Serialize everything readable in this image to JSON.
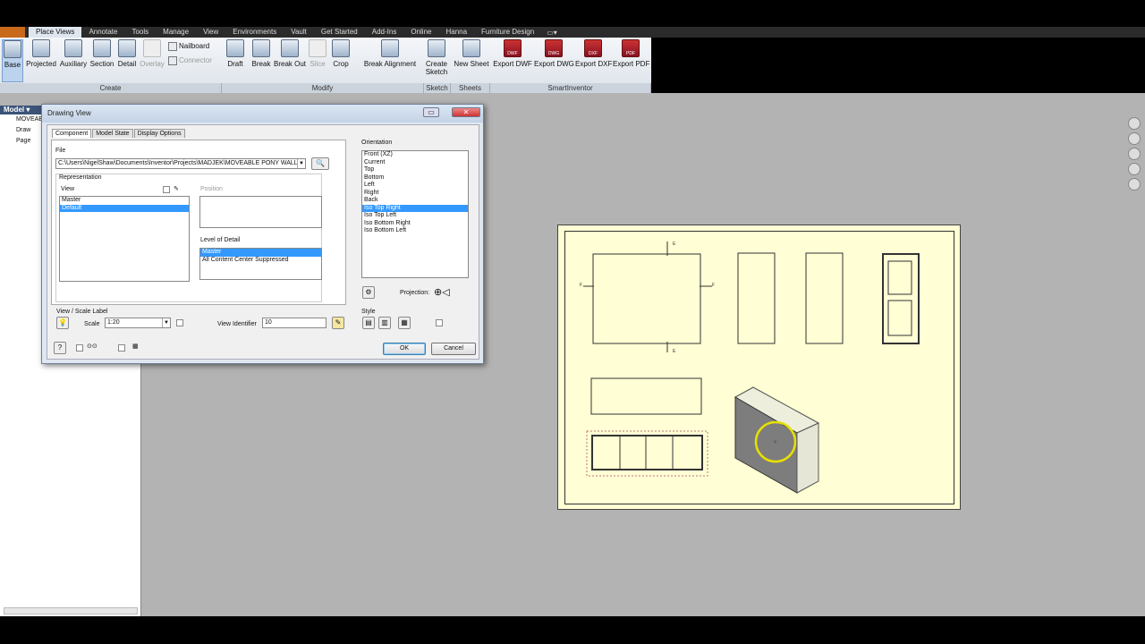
{
  "ribbon": {
    "tabs": [
      "Place Views",
      "Annotate",
      "Tools",
      "Manage",
      "View",
      "Environments",
      "Vault",
      "Get Started",
      "Add-Ins",
      "Online",
      "Hanna",
      "Furniture Design"
    ],
    "active_tab": "Place Views",
    "create": {
      "base": "Base",
      "projected": "Projected",
      "auxiliary": "Auxiliary",
      "section": "Section",
      "detail": "Detail",
      "overlay": "Overlay",
      "nailboard": "Nailboard",
      "connector": "Connector"
    },
    "modify": {
      "draft": "Draft",
      "break": "Break",
      "break_out": "Break Out",
      "slice": "Slice",
      "crop": "Crop",
      "break_alignment": "Break Alignment"
    },
    "sketch": {
      "create_sketch_line1": "Create",
      "create_sketch_line2": "Sketch"
    },
    "sheets": {
      "new_sheet": "New Sheet"
    },
    "smartinventor": {
      "export_dwf": "Export DWF",
      "export_dwg": "Export DWG",
      "export_dxf": "Export DXF",
      "export_pdf": "Export PDF",
      "dwf": "DWF",
      "dwg": "DWG",
      "dxf": "DXF",
      "pdf": "PDF"
    },
    "groups": {
      "create": "Create",
      "modify": "Modify",
      "sketch": "Sketch",
      "sheets": "Sheets",
      "smartinventor": "SmartInventor"
    }
  },
  "browser": {
    "title": "Model ▾",
    "rows": [
      "MOVEAB",
      "Draw",
      "Page",
      "",
      "",
      "",
      "",
      "",
      "",
      "",
      "",
      ""
    ]
  },
  "dialog": {
    "title": "Drawing View",
    "tabs": [
      "Component",
      "Model State",
      "Display Options"
    ],
    "file_label": "File",
    "file_path": "C:\\Users\\NigelShaw\\Documents\\Inventor\\Projects\\MADJEK\\MOVEABLE PONY WALL",
    "representation_label": "Representation",
    "view_label": "View",
    "view_items": [
      "Master",
      "Default"
    ],
    "view_selected": 1,
    "position_label": "Position",
    "lod_label": "Level of Detail",
    "lod_items": [
      "Master",
      "All Content Center Suppressed"
    ],
    "lod_selected": 0,
    "scale_section_label": "View / Scale Label",
    "scale_label": "Scale",
    "scale_value": "1:20",
    "view_identifier_label": "View Identifier",
    "view_identifier_value": "10",
    "orientation_label": "Orientation",
    "orientation_items": [
      "Front (XZ)",
      "Current",
      "Top",
      "Bottom",
      "Left",
      "Right",
      "Back",
      "Iso Top Right",
      "Iso Top Left",
      "Iso Bottom Right",
      "Iso Bottom Left"
    ],
    "orientation_selected": 7,
    "projection_label": "Projection:",
    "style_label": "Style",
    "ok_label": "OK",
    "cancel_label": "Cancel"
  },
  "sheet": {
    "section_labels": [
      "E",
      "E",
      "F",
      "F"
    ]
  },
  "colors": {
    "accent": "#3399ff",
    "sheet": "#fffed4",
    "ribbon_dark": "#2b2b2b",
    "highlight_circle": "#e8e000"
  }
}
